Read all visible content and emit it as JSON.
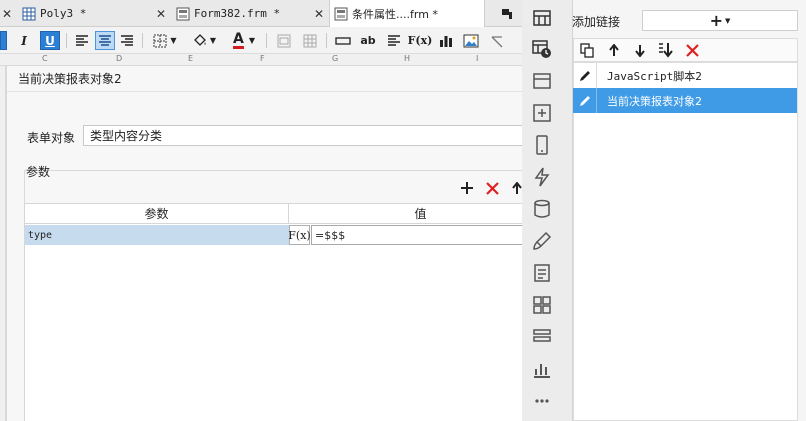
{
  "tabs": [
    {
      "label": "Poly3 *"
    },
    {
      "label": "Form382.frm *"
    },
    {
      "label": "条件属性....frm *"
    }
  ],
  "toolbar": {
    "italic": "I",
    "underline": "U",
    "text_color": "A",
    "ab": "ab",
    "fx": "F(x)"
  },
  "columns": [
    "C",
    "D",
    "E",
    "F",
    "G",
    "H",
    "I"
  ],
  "dialog": {
    "title": "当前决策报表对象2",
    "form_object_label": "表单对象",
    "form_object_value": "类型内容分类",
    "params_label": "参数",
    "params_table": {
      "headers": [
        "参数",
        "值"
      ],
      "rows": [
        {
          "name": "type",
          "fx": "F(x)",
          "value": "=$$$"
        }
      ]
    }
  },
  "right_panel": {
    "add_link_label": "添加链接",
    "add_button_label": "+",
    "links": [
      {
        "label": "JavaScript脚本2",
        "selected": false
      },
      {
        "label": "当前决策报表对象2",
        "selected": true
      }
    ]
  },
  "colors": {
    "accent": "#2d7fd3",
    "selected_row": "#3f9be6",
    "delete_red": "#e02020",
    "param_row": "#c6dcee"
  }
}
